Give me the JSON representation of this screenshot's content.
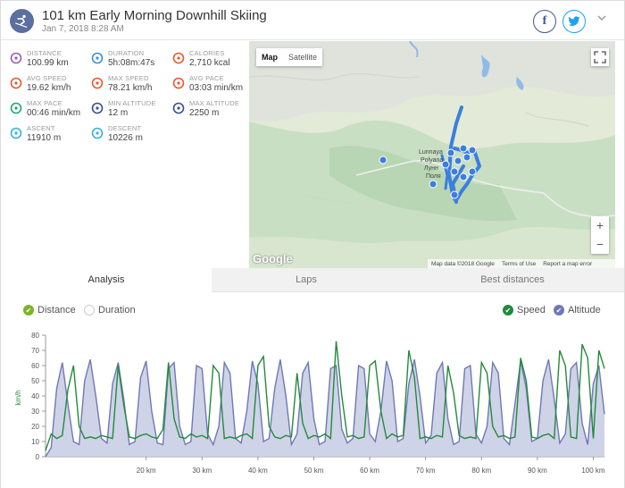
{
  "header": {
    "title": "101 km Early Morning Downhill Skiing",
    "date": "Jan 7, 2018 8:28 AM",
    "facebook_label": "f",
    "twitter_label": "t",
    "more_label": "⌄"
  },
  "stats": [
    {
      "label": "DISTANCE",
      "value": "100.99 km",
      "icon": "distance-icon",
      "color": "#9c5cb4"
    },
    {
      "label": "DURATION",
      "value": "5h:08m:47s",
      "icon": "stopwatch-icon",
      "color": "#3a8fd8"
    },
    {
      "label": "CALORIES",
      "value": "2,710 kcal",
      "icon": "flame-icon",
      "color": "#e8592c"
    },
    {
      "label": "AVG SPEED",
      "value": "19.62 km/h",
      "icon": "speedometer-icon",
      "color": "#e8592c"
    },
    {
      "label": "MAX SPEED",
      "value": "78.21 km/h",
      "icon": "speedometer-icon",
      "color": "#e8592c"
    },
    {
      "label": "AVG PACE",
      "value": "03:03 min/km",
      "icon": "pace-icon",
      "color": "#e8592c"
    },
    {
      "label": "MAX PACE",
      "value": "00:46 min/km",
      "icon": "pace-icon",
      "color": "#1fa672"
    },
    {
      "label": "MIN ALTITUDE",
      "value": "12 m",
      "icon": "mountain-icon",
      "color": "#3a4d8f"
    },
    {
      "label": "MAX ALTITUDE",
      "value": "2250 m",
      "icon": "mountain-icon",
      "color": "#3a4d8f"
    },
    {
      "label": "ASCENT",
      "value": "11910 m",
      "icon": "ascent-icon",
      "color": "#3ab0d8"
    },
    {
      "label": "DESCENT",
      "value": "10226 m",
      "icon": "descent-icon",
      "color": "#3ab0d8"
    }
  ],
  "map": {
    "tab_map": "Map",
    "tab_satellite": "Satellite",
    "zoom_in": "+",
    "zoom_out": "−",
    "logo": "Google",
    "attribution": [
      "Map data ©2018 Google",
      "Terms of Use",
      "Report a map error"
    ],
    "place_line1": "Lunnaya",
    "place_line2": "Polyana",
    "place_line3": "Лунн",
    "place_line4": "Поля",
    "route_color": "#3c7ee0"
  },
  "tabs": [
    "Analysis",
    "Laps",
    "Best distances"
  ],
  "active_tab": 0,
  "toggles": {
    "distance": "Distance",
    "duration": "Duration",
    "speed": "Speed",
    "altitude": "Altitude"
  },
  "colors": {
    "speed_line": "#238a3c",
    "altitude_fill": "#c7cbe3",
    "altitude_line": "#6f78b5",
    "distance_check": "#7fb32a",
    "speed_check": "#238a3c",
    "altitude_check": "#6f78b5"
  },
  "chart_data": {
    "type": "line",
    "xlabel": "",
    "ylabel": "km/h",
    "x_tick_labels": [
      "20 km",
      "30 km",
      "40 km",
      "50 km",
      "60 km",
      "70 km",
      "80 km",
      "90 km",
      "100 km"
    ],
    "y_tick_labels": [
      "0",
      "10",
      "20",
      "30",
      "40",
      "50",
      "60",
      "70",
      "80"
    ],
    "xlim": [
      2,
      102
    ],
    "ylim": [
      0,
      80
    ],
    "series": [
      {
        "name": "Speed",
        "x": [
          2,
          3,
          4,
          5,
          6,
          7,
          8,
          9,
          10,
          11,
          12,
          13,
          14,
          15,
          16,
          17,
          18,
          19,
          20,
          21,
          22,
          23,
          24,
          25,
          26,
          27,
          28,
          29,
          30,
          31,
          32,
          33,
          34,
          35,
          36,
          37,
          38,
          39,
          40,
          41,
          42,
          43,
          44,
          45,
          46,
          47,
          48,
          49,
          50,
          51,
          52,
          53,
          54,
          55,
          56,
          57,
          58,
          59,
          60,
          61,
          62,
          63,
          64,
          65,
          66,
          67,
          68,
          69,
          70,
          71,
          72,
          73,
          74,
          75,
          76,
          77,
          78,
          79,
          80,
          81,
          82,
          83,
          84,
          85,
          86,
          87,
          88,
          89,
          90,
          91,
          92,
          93,
          94,
          95,
          96,
          97,
          98,
          99,
          100,
          101,
          102
        ],
        "values": [
          4,
          15,
          12,
          14,
          44,
          60,
          20,
          12,
          13,
          12,
          14,
          13,
          12,
          60,
          34,
          13,
          12,
          14,
          15,
          13,
          12,
          18,
          62,
          25,
          13,
          12,
          15,
          13,
          14,
          12,
          60,
          55,
          12,
          13,
          12,
          14,
          15,
          12,
          60,
          66,
          20,
          13,
          12,
          14,
          13,
          55,
          22,
          12,
          14,
          13,
          15,
          12,
          76,
          40,
          13,
          14,
          12,
          13,
          60,
          63,
          30,
          12,
          15,
          13,
          14,
          70,
          52,
          12,
          13,
          12,
          14,
          13,
          60,
          42,
          14,
          12,
          13,
          12,
          62,
          55,
          20,
          13,
          14,
          12,
          13,
          65,
          50,
          13,
          12,
          14,
          15,
          12,
          70,
          60,
          13,
          12,
          74,
          65,
          12,
          70,
          58
        ]
      },
      {
        "name": "Altitude",
        "x": [
          2,
          3,
          4,
          5,
          6,
          7,
          8,
          9,
          10,
          11,
          12,
          13,
          14,
          15,
          16,
          17,
          18,
          19,
          20,
          21,
          22,
          23,
          24,
          25,
          26,
          27,
          28,
          29,
          30,
          31,
          32,
          33,
          34,
          35,
          36,
          37,
          38,
          39,
          40,
          41,
          42,
          43,
          44,
          45,
          46,
          47,
          48,
          49,
          50,
          51,
          52,
          53,
          54,
          55,
          56,
          57,
          58,
          59,
          60,
          61,
          62,
          63,
          64,
          65,
          66,
          67,
          68,
          69,
          70,
          71,
          72,
          73,
          74,
          75,
          76,
          77,
          78,
          79,
          80,
          81,
          82,
          83,
          84,
          85,
          86,
          87,
          88,
          89,
          90,
          91,
          92,
          93,
          94,
          95,
          96,
          97,
          98,
          99,
          100,
          101,
          102
        ],
        "values": [
          0,
          6,
          45,
          62,
          35,
          10,
          8,
          50,
          64,
          40,
          12,
          9,
          48,
          62,
          38,
          8,
          10,
          52,
          63,
          30,
          9,
          8,
          58,
          62,
          20,
          8,
          10,
          60,
          58,
          15,
          8,
          20,
          62,
          55,
          12,
          9,
          30,
          63,
          48,
          10,
          12,
          45,
          64,
          40,
          8,
          15,
          55,
          62,
          25,
          8,
          10,
          58,
          60,
          18,
          9,
          12,
          60,
          58,
          15,
          10,
          30,
          63,
          50,
          10,
          12,
          48,
          64,
          40,
          9,
          14,
          55,
          62,
          25,
          8,
          10,
          58,
          60,
          15,
          9,
          20,
          62,
          55,
          12,
          8,
          35,
          63,
          45,
          10,
          12,
          50,
          64,
          38,
          9,
          15,
          58,
          62,
          22,
          8,
          48,
          60,
          28
        ]
      }
    ]
  }
}
